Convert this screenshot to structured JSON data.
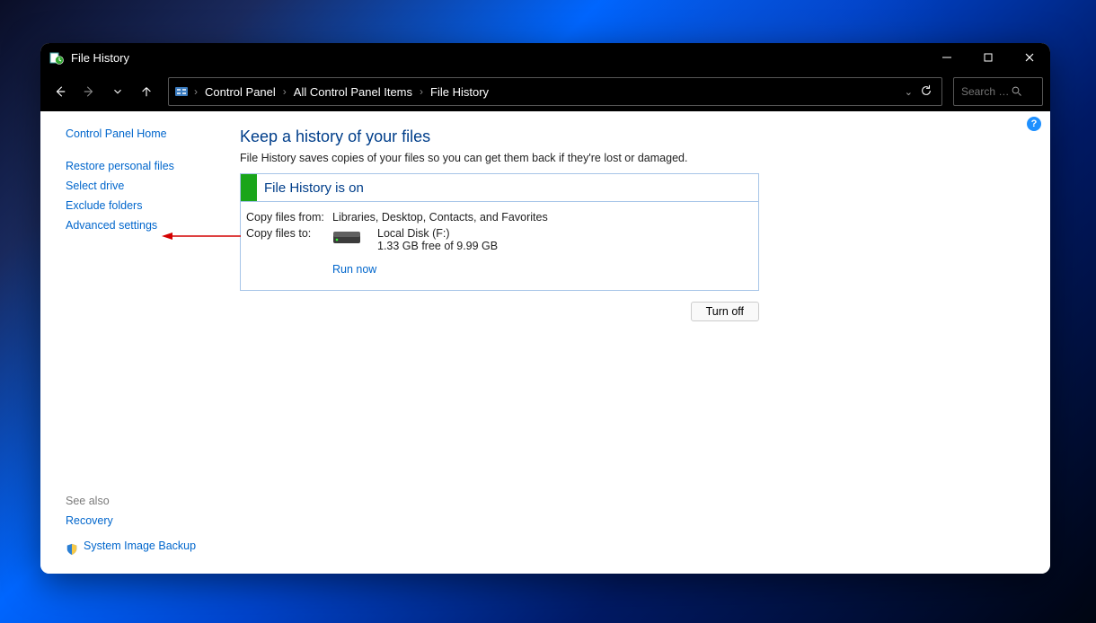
{
  "window": {
    "title": "File History"
  },
  "breadcrumb": {
    "items": [
      "Control Panel",
      "All Control Panel Items",
      "File History"
    ]
  },
  "search": {
    "placeholder": "Search …"
  },
  "sidebar": {
    "home": "Control Panel Home",
    "links": [
      "Restore personal files",
      "Select drive",
      "Exclude folders",
      "Advanced settings"
    ],
    "see_also_header": "See also",
    "see_also": [
      "Recovery",
      "System Image Backup"
    ]
  },
  "main": {
    "heading": "Keep a history of your files",
    "description": "File History saves copies of your files so you can get them back if they're lost or damaged.",
    "status": "File History is on",
    "copy_from_label": "Copy files from:",
    "copy_from_value": "Libraries, Desktop, Contacts, and Favorites",
    "copy_to_label": "Copy files to:",
    "drive_name": "Local Disk (F:)",
    "drive_free": "1.33 GB free of 9.99 GB",
    "run_now": "Run now",
    "turn_off": "Turn off"
  },
  "help_badge": "?"
}
